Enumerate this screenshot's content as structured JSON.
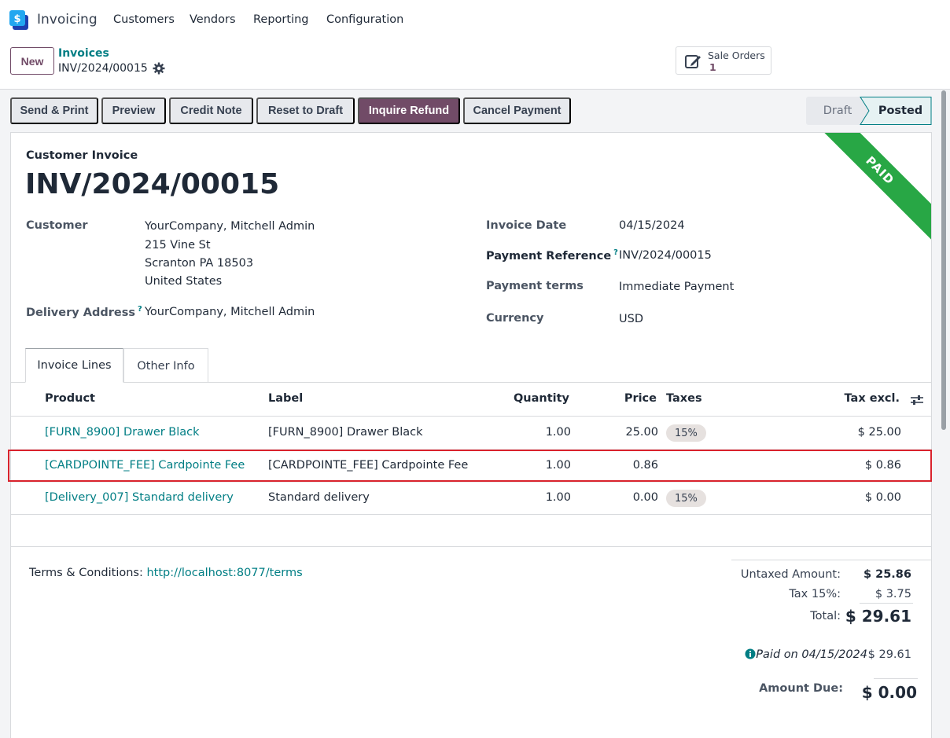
{
  "nav": {
    "app_name": "Invoicing",
    "menu": [
      "Customers",
      "Vendors",
      "Reporting",
      "Configuration"
    ]
  },
  "control_panel": {
    "new_label": "New",
    "breadcrumb_parent": "Invoices",
    "breadcrumb_current": "INV/2024/00015",
    "smart_button": {
      "label": "Sale Orders",
      "value": "1"
    }
  },
  "actions": [
    "Send & Print",
    "Preview",
    "Credit Note",
    "Reset to Draft",
    "Inquire Refund",
    "Cancel Payment"
  ],
  "status": {
    "draft": "Draft",
    "posted": "Posted"
  },
  "ribbon": "PAID",
  "invoice": {
    "type": "Customer Invoice",
    "number": "INV/2024/00015",
    "customer_label": "Customer",
    "customer": "YourCompany, Mitchell Admin",
    "address": [
      "215 Vine St",
      "Scranton PA 18503",
      "United States"
    ],
    "delivery_label": "Delivery Address",
    "delivery": "YourCompany, Mitchell Admin",
    "help_mark": "?",
    "invoice_date_label": "Invoice Date",
    "invoice_date": "04/15/2024",
    "payment_ref_label": "Payment Reference",
    "payment_ref": "INV/2024/00015",
    "payment_terms_label": "Payment terms",
    "payment_terms": "Immediate Payment",
    "currency_label": "Currency",
    "currency": "USD"
  },
  "tabs": [
    "Invoice Lines",
    "Other Info"
  ],
  "lines": {
    "headers": [
      "Product",
      "Label",
      "Quantity",
      "Price",
      "Taxes",
      "Tax excl."
    ],
    "rows": [
      {
        "product": "[FURN_8900] Drawer Black",
        "label": "[FURN_8900] Drawer Black",
        "quantity": "1.00",
        "price": "25.00",
        "tax": "15%",
        "subtotal": "$ 25.00"
      },
      {
        "product": "[CARDPOINTE_FEE] Cardpointe Fee",
        "label": "[CARDPOINTE_FEE] Cardpointe Fee",
        "quantity": "1.00",
        "price": "0.86",
        "tax": "",
        "subtotal": "$ 0.86"
      },
      {
        "product": "[Delivery_007] Standard delivery",
        "label": "Standard delivery",
        "quantity": "1.00",
        "price": "0.00",
        "tax": "15%",
        "subtotal": "$ 0.00"
      }
    ]
  },
  "terms": {
    "label": "Terms & Conditions:",
    "link": "http://localhost:8077/terms"
  },
  "totals": {
    "untaxed_label": "Untaxed Amount:",
    "untaxed": "$ 25.86",
    "tax_label": "Tax 15%:",
    "tax": "$ 3.75",
    "total_label": "Total:",
    "total": "$ 29.61",
    "paid_label": "Paid on 04/15/2024",
    "paid": "$ 29.61",
    "due_label": "Amount Due:",
    "due": "$ 0.00"
  }
}
